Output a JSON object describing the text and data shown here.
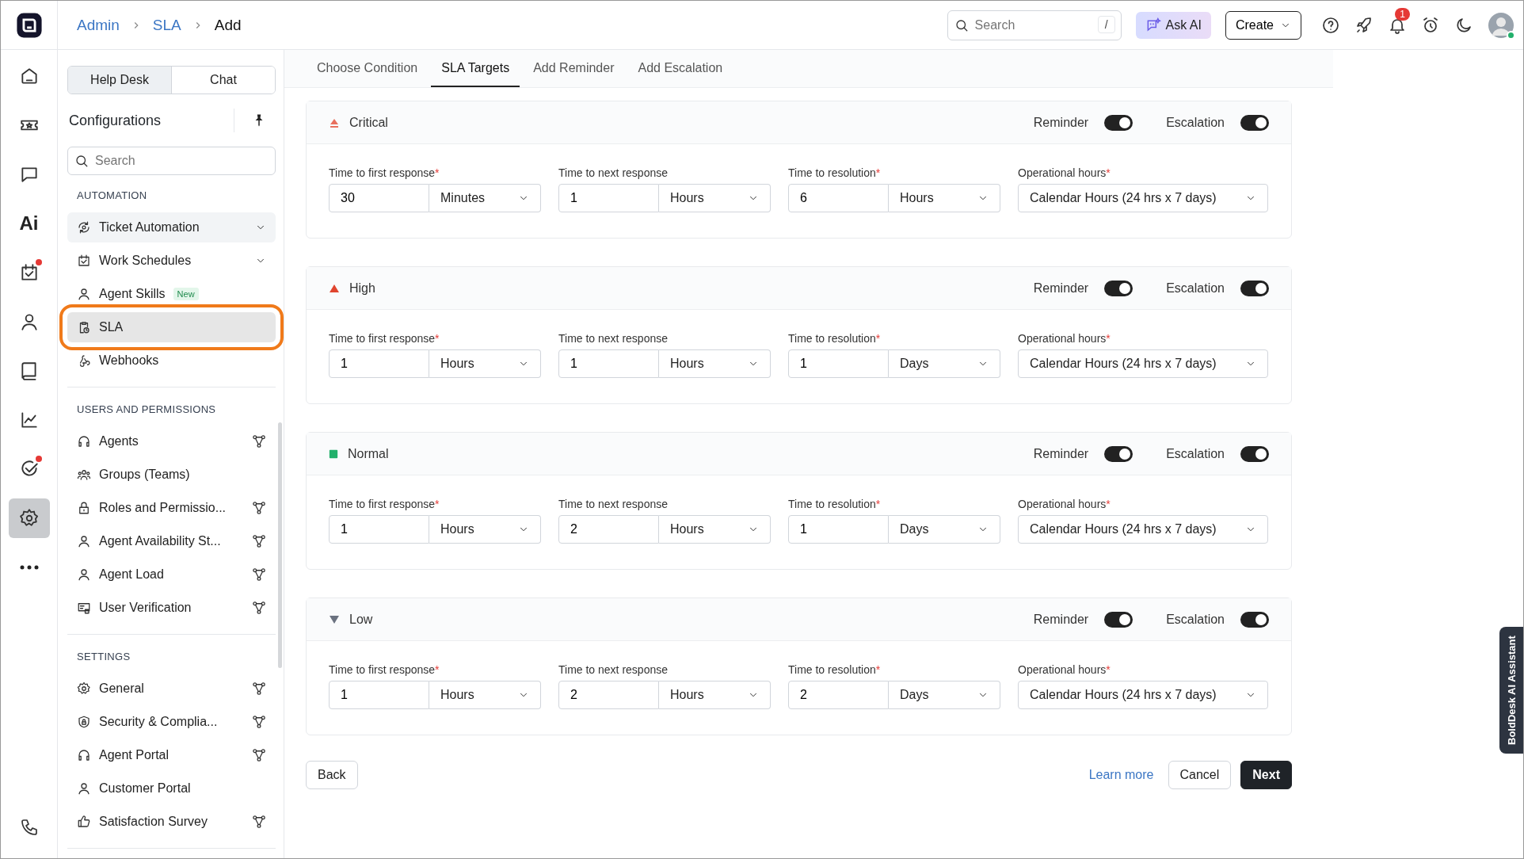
{
  "breadcrumb": [
    {
      "label": "Admin",
      "link": true
    },
    {
      "label": "SLA",
      "link": true
    },
    {
      "label": "Add",
      "link": false
    }
  ],
  "topbar": {
    "search": {
      "placeholder": "Search",
      "shortcut": "/"
    },
    "ask_ai": "Ask AI",
    "create": "Create",
    "notifications": "1"
  },
  "rail": [
    {
      "selected": false,
      "dot": false
    },
    {
      "selected": false,
      "dot": false
    },
    {
      "selected": false,
      "dot": false
    },
    {
      "label": "Ai",
      "selected": false,
      "dot": false
    },
    {
      "selected": false,
      "dot": true
    },
    {
      "selected": false,
      "dot": false
    },
    {
      "selected": false,
      "dot": false
    },
    {
      "selected": false,
      "dot": false
    },
    {
      "selected": false,
      "dot": true
    },
    {
      "selected": true,
      "dot": false
    },
    {
      "selected": false,
      "dot": false
    }
  ],
  "sidebar": {
    "switch": [
      {
        "label": "Help Desk",
        "selected": true
      },
      {
        "label": "Chat",
        "selected": false
      }
    ],
    "title": "Configurations",
    "search": {
      "placeholder": "Search"
    },
    "sections": [
      {
        "title": "AUTOMATION",
        "items": [
          {
            "label": "Ticket Automation",
            "expandable": true,
            "hovered": true,
            "selected": false,
            "highlight": false,
            "branch": false
          },
          {
            "label": "Work Schedules",
            "expandable": true,
            "hovered": false,
            "selected": false,
            "highlight": false,
            "branch": false
          },
          {
            "label": "Agent Skills",
            "badge": "New",
            "expandable": false,
            "hovered": false,
            "selected": false,
            "highlight": false,
            "branch": false
          },
          {
            "label": "SLA",
            "expandable": false,
            "hovered": false,
            "selected": true,
            "highlight": true,
            "branch": false
          },
          {
            "label": "Webhooks",
            "expandable": false,
            "hovered": false,
            "selected": false,
            "highlight": false,
            "branch": false
          }
        ]
      },
      {
        "title": "USERS AND PERMISSIONS",
        "items": [
          {
            "label": "Agents",
            "expandable": false,
            "hovered": false,
            "selected": false,
            "highlight": false,
            "branch": true
          },
          {
            "label": "Groups (Teams)",
            "expandable": false,
            "hovered": false,
            "selected": false,
            "highlight": false,
            "branch": false
          },
          {
            "label": "Roles and Permissio...",
            "expandable": false,
            "hovered": false,
            "selected": false,
            "highlight": false,
            "branch": true
          },
          {
            "label": "Agent Availability St...",
            "expandable": false,
            "hovered": false,
            "selected": false,
            "highlight": false,
            "branch": true
          },
          {
            "label": "Agent Load",
            "expandable": false,
            "hovered": false,
            "selected": false,
            "highlight": false,
            "branch": true
          },
          {
            "label": "User Verification",
            "expandable": false,
            "hovered": false,
            "selected": false,
            "highlight": false,
            "branch": true
          }
        ]
      },
      {
        "title": "SETTINGS",
        "items": [
          {
            "label": "General",
            "expandable": false,
            "hovered": false,
            "selected": false,
            "highlight": false,
            "branch": true
          },
          {
            "label": "Security & Complia...",
            "expandable": false,
            "hovered": false,
            "selected": false,
            "highlight": false,
            "branch": true
          },
          {
            "label": "Agent Portal",
            "expandable": false,
            "hovered": false,
            "selected": false,
            "highlight": false,
            "branch": true
          },
          {
            "label": "Customer Portal",
            "expandable": false,
            "hovered": false,
            "selected": false,
            "highlight": false,
            "branch": false
          },
          {
            "label": "Satisfaction Survey",
            "expandable": false,
            "hovered": false,
            "selected": false,
            "highlight": false,
            "branch": true
          }
        ]
      }
    ]
  },
  "steps": [
    {
      "label": "Choose Condition",
      "selected": false
    },
    {
      "label": "SLA Targets",
      "selected": true
    },
    {
      "label": "Add Reminder",
      "selected": false
    },
    {
      "label": "Add Escalation",
      "selected": false
    }
  ],
  "priorities": [
    {
      "name": "Critical",
      "kind": "critical",
      "color": "#e8705e",
      "reminder": {
        "label": "Reminder",
        "on": true
      },
      "escalation": {
        "label": "Escalation",
        "on": true
      },
      "fields": [
        {
          "kind": "duration",
          "label": "Time to first response",
          "required_mark": "*",
          "value": "30",
          "unit": "Minutes"
        },
        {
          "kind": "duration",
          "label": "Time to next response",
          "value": "1",
          "unit": "Hours"
        },
        {
          "kind": "duration",
          "label": "Time to resolution",
          "required_mark": "*",
          "value": "6",
          "unit": "Hours"
        },
        {
          "kind": "select",
          "label": "Operational hours",
          "required_mark": "*",
          "value": "Calendar Hours (24 hrs x 7 days)"
        }
      ]
    },
    {
      "name": "High",
      "kind": "up",
      "color": "#e0452f",
      "reminder": {
        "label": "Reminder",
        "on": true
      },
      "escalation": {
        "label": "Escalation",
        "on": true
      },
      "fields": [
        {
          "kind": "duration",
          "label": "Time to first response",
          "required_mark": "*",
          "value": "1",
          "unit": "Hours"
        },
        {
          "kind": "duration",
          "label": "Time to next response",
          "value": "1",
          "unit": "Hours"
        },
        {
          "kind": "duration",
          "label": "Time to resolution",
          "required_mark": "*",
          "value": "1",
          "unit": "Days"
        },
        {
          "kind": "select",
          "label": "Operational hours",
          "required_mark": "*",
          "value": "Calendar Hours (24 hrs x 7 days)"
        }
      ]
    },
    {
      "name": "Normal",
      "kind": "square",
      "color": "#22b06b",
      "reminder": {
        "label": "Reminder",
        "on": true
      },
      "escalation": {
        "label": "Escalation",
        "on": true
      },
      "fields": [
        {
          "kind": "duration",
          "label": "Time to first response",
          "required_mark": "*",
          "value": "1",
          "unit": "Hours"
        },
        {
          "kind": "duration",
          "label": "Time to next response",
          "value": "2",
          "unit": "Hours"
        },
        {
          "kind": "duration",
          "label": "Time to resolution",
          "required_mark": "*",
          "value": "1",
          "unit": "Days"
        },
        {
          "kind": "select",
          "label": "Operational hours",
          "required_mark": "*",
          "value": "Calendar Hours (24 hrs x 7 days)"
        }
      ]
    },
    {
      "name": "Low",
      "kind": "down",
      "color": "#6b7280",
      "reminder": {
        "label": "Reminder",
        "on": true
      },
      "escalation": {
        "label": "Escalation",
        "on": true
      },
      "fields": [
        {
          "kind": "duration",
          "label": "Time to first response",
          "required_mark": "*",
          "value": "1",
          "unit": "Hours"
        },
        {
          "kind": "duration",
          "label": "Time to next response",
          "value": "2",
          "unit": "Hours"
        },
        {
          "kind": "duration",
          "label": "Time to resolution",
          "required_mark": "*",
          "value": "2",
          "unit": "Days"
        },
        {
          "kind": "select",
          "label": "Operational hours",
          "required_mark": "*",
          "value": "Calendar Hours (24 hrs x 7 days)"
        }
      ]
    }
  ],
  "footer": {
    "back": "Back",
    "learn_more": "Learn more",
    "cancel": "Cancel",
    "next": "Next"
  },
  "assistant_tab": "BoldDesk AI Assistant"
}
